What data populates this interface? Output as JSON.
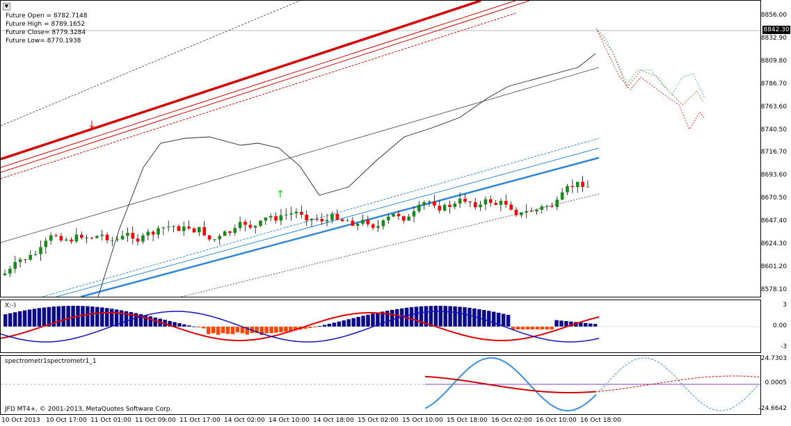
{
  "main_chart": {
    "info_lines": [
      "Future Open = 8782.7148",
      "Future High = 8789.1652",
      "Future Close= 8779.3284",
      "Future Low= 8770.1938"
    ],
    "current_price": "8842.30",
    "y_ticks": [
      "8856.00",
      "8832.90",
      "8809.80",
      "8786.70",
      "8763.60",
      "8740.50",
      "8716.70",
      "8693.60",
      "8670.50",
      "8647.40",
      "8624.30",
      "8601.20",
      "8578.10"
    ],
    "watermark": "JFD MT4+, © 2001-2013, MetaQuotes Software Corp.",
    "colors": {
      "bull": "#1a8a1a",
      "bear": "#ff0000",
      "upper_band": "#d40000",
      "lower_band": "#2f86d8",
      "arrow_up": "#00d400"
    }
  },
  "oscillator": {
    "label": "X:-)",
    "y_ticks": [
      "3",
      "0.00",
      "-3"
    ],
    "colors": {
      "hist_pos": "#0a0a8a",
      "hist_neg": "#ff4500",
      "line_red": "#e00000",
      "line_blue": "#1010c0"
    }
  },
  "spectrometer": {
    "label": "spectrometr1spectrometr1_1",
    "y_ticks": [
      "24.7303",
      "0.0005",
      "-24.6642"
    ]
  },
  "x_axis_labels": [
    "10 Oct 2013",
    "10 Oct 17:00",
    "11 Oct 01:00",
    "11 Oct 09:00",
    "11 Oct 17:00",
    "14 Oct 02:00",
    "14 Oct 10:00",
    "14 Oct 18:00",
    "15 Oct 02:00",
    "15 Oct 10:00",
    "15 Oct 18:00",
    "16 Oct 02:00",
    "16 Oct 10:00",
    "16 Oct 18:00"
  ]
}
